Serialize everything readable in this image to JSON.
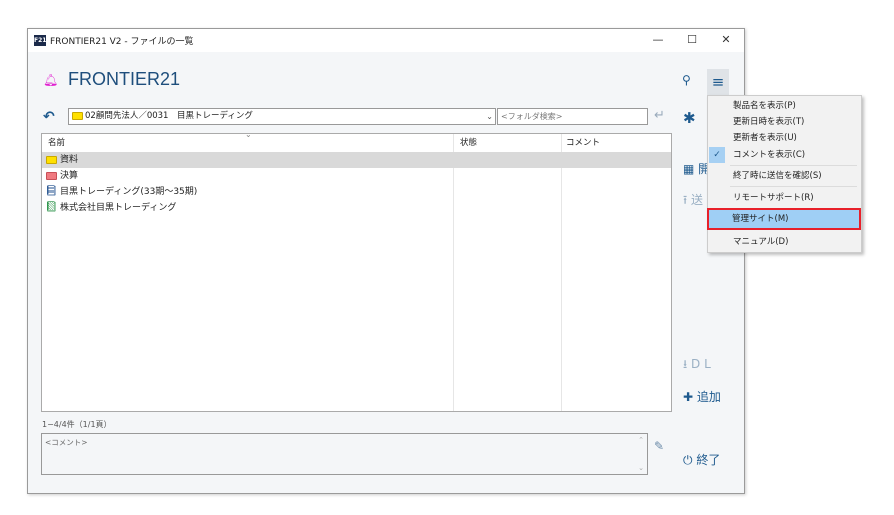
{
  "window": {
    "title": "FRONTIER21 V2 - ファイルの一覧",
    "app_icon": "F21",
    "minimize": "—",
    "maximize": "☐",
    "close": "✕"
  },
  "header": {
    "brand": "FRONTIER21",
    "bell_color": "#e020d0"
  },
  "path": {
    "value": "02顧問先法人／0031　目黒トレーディング",
    "folder_search_placeholder": "<フォルダ検索>"
  },
  "table": {
    "columns": [
      "名前",
      "状態",
      "コメント"
    ],
    "rows": [
      {
        "name": "資料",
        "type": "folder-yellow",
        "selected": true
      },
      {
        "name": "決算",
        "type": "folder-red"
      },
      {
        "name": "目黒トレーディング(33期～35期)",
        "type": "binder-blue"
      },
      {
        "name": "株式会社目黒トレーディング",
        "type": "binder-green"
      }
    ]
  },
  "status": "1−4/4件（1/1頁）",
  "comment_placeholder": "<コメント>",
  "side": {
    "open_partial": "開",
    "send_partial": "送",
    "dl": "D L",
    "add": "追加",
    "exit": "終了"
  },
  "menu": {
    "items": [
      {
        "label": "製品名を表示(P)"
      },
      {
        "label": "更新日時を表示(T)"
      },
      {
        "label": "更新者を表示(U)"
      },
      {
        "label": "コメントを表示(C)",
        "checked": true
      },
      {
        "label": "終了時に送信を確認(S)"
      },
      {
        "label": "リモートサポート(R)"
      },
      {
        "label": "管理サイト(M)",
        "highlighted": true
      },
      {
        "label": "マニュアル(D)"
      }
    ]
  },
  "colors": {
    "accent": "#1e5a8e",
    "highlight": "#9fcff5",
    "highlight_border": "#e8202a"
  }
}
